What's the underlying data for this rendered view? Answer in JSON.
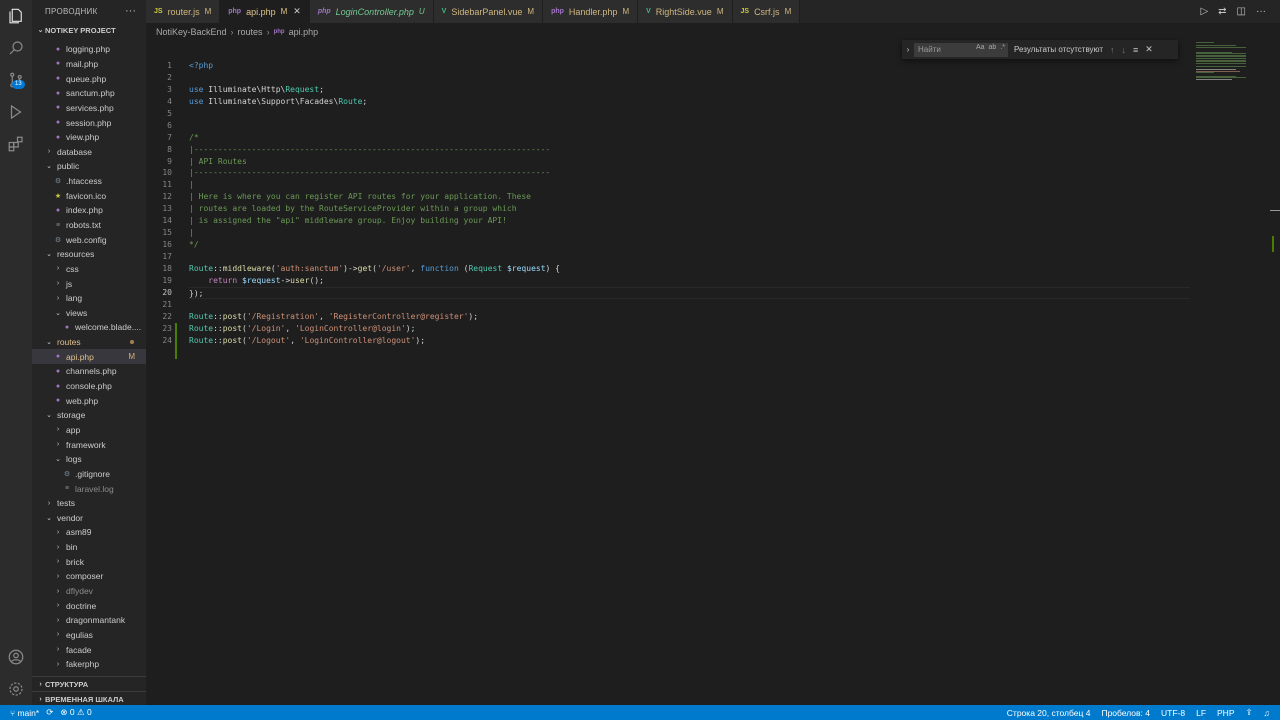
{
  "activity": {
    "icons": [
      "explorer-icon",
      "search-icon",
      "source-control-icon",
      "run-debug-icon",
      "extensions-icon",
      "account-icon",
      "manage-gear-icon"
    ],
    "source_control_badge": "13"
  },
  "sidebar": {
    "title": "ПРОВОДНИК",
    "more": "···",
    "project": "NOTIKEY PROJECT",
    "tree": [
      {
        "label": "logging.php",
        "type": "php",
        "indent": 2
      },
      {
        "label": "mail.php",
        "type": "php",
        "indent": 2
      },
      {
        "label": "queue.php",
        "type": "php",
        "indent": 2
      },
      {
        "label": "sanctum.php",
        "type": "php",
        "indent": 2
      },
      {
        "label": "services.php",
        "type": "php",
        "indent": 2
      },
      {
        "label": "session.php",
        "type": "php",
        "indent": 2
      },
      {
        "label": "view.php",
        "type": "php",
        "indent": 2
      },
      {
        "label": "database",
        "type": "folder-closed",
        "indent": 1
      },
      {
        "label": "public",
        "type": "folder-open",
        "indent": 1
      },
      {
        "label": ".htaccess",
        "type": "gear",
        "indent": 2
      },
      {
        "label": "favicon.ico",
        "type": "star",
        "indent": 2
      },
      {
        "label": "index.php",
        "type": "php",
        "indent": 2
      },
      {
        "label": "robots.txt",
        "type": "lines",
        "indent": 2
      },
      {
        "label": "web.config",
        "type": "gear",
        "indent": 2
      },
      {
        "label": "resources",
        "type": "folder-open",
        "indent": 1
      },
      {
        "label": "css",
        "type": "folder-closed",
        "indent": 2
      },
      {
        "label": "js",
        "type": "folder-closed",
        "indent": 2
      },
      {
        "label": "lang",
        "type": "folder-closed",
        "indent": 2
      },
      {
        "label": "views",
        "type": "folder-open",
        "indent": 2
      },
      {
        "label": "welcome.blade....",
        "type": "php",
        "indent": 3
      },
      {
        "label": "routes",
        "type": "folder-open",
        "indent": 1,
        "status": "dot"
      },
      {
        "label": "api.php",
        "type": "php",
        "indent": 2,
        "status": "M",
        "selected": true
      },
      {
        "label": "channels.php",
        "type": "php",
        "indent": 2
      },
      {
        "label": "console.php",
        "type": "php",
        "indent": 2
      },
      {
        "label": "web.php",
        "type": "php",
        "indent": 2
      },
      {
        "label": "storage",
        "type": "folder-open",
        "indent": 1
      },
      {
        "label": "app",
        "type": "folder-closed",
        "indent": 2
      },
      {
        "label": "framework",
        "type": "folder-closed",
        "indent": 2
      },
      {
        "label": "logs",
        "type": "folder-open",
        "indent": 2
      },
      {
        "label": ".gitignore",
        "type": "gear",
        "indent": 3
      },
      {
        "label": "laravel.log",
        "type": "lines",
        "indent": 3,
        "dim": true
      },
      {
        "label": "tests",
        "type": "folder-closed",
        "indent": 1
      },
      {
        "label": "vendor",
        "type": "folder-open",
        "indent": 1
      },
      {
        "label": "asm89",
        "type": "folder-closed",
        "indent": 2
      },
      {
        "label": "bin",
        "type": "folder-closed",
        "indent": 2
      },
      {
        "label": "brick",
        "type": "folder-closed",
        "indent": 2
      },
      {
        "label": "composer",
        "type": "folder-closed",
        "indent": 2
      },
      {
        "label": "dflydev",
        "type": "folder-closed",
        "indent": 2,
        "dim": true
      },
      {
        "label": "doctrine",
        "type": "folder-closed",
        "indent": 2
      },
      {
        "label": "dragonmantank",
        "type": "folder-closed",
        "indent": 2
      },
      {
        "label": "egulias",
        "type": "folder-closed",
        "indent": 2
      },
      {
        "label": "facade",
        "type": "folder-closed",
        "indent": 2
      },
      {
        "label": "fakerphp",
        "type": "folder-closed",
        "indent": 2
      }
    ],
    "outline": "СТРУКТУРА",
    "timeline": "ВРЕМЕННАЯ ШКАЛА"
  },
  "tabs": [
    {
      "icon": "JS",
      "label": "router.js",
      "mark": "M",
      "kind": "js"
    },
    {
      "icon": "php",
      "label": "api.php",
      "mark": "M",
      "kind": "php",
      "active": true,
      "close": "✕"
    },
    {
      "icon": "php",
      "label": "LoginController.php",
      "mark": "U",
      "kind": "php",
      "untracked": true
    },
    {
      "icon": "V",
      "label": "SidebarPanel.vue",
      "mark": "M",
      "kind": "vue"
    },
    {
      "icon": "php",
      "label": "Handler.php",
      "mark": "M",
      "kind": "php"
    },
    {
      "icon": "V",
      "label": "RightSide.vue",
      "mark": "M",
      "kind": "vue"
    },
    {
      "icon": "JS",
      "label": "Csrf.js",
      "mark": "M",
      "kind": "js"
    }
  ],
  "breadcrumb": {
    "root": "NotiKey-BackEnd",
    "folder": "routes",
    "file": "api.php",
    "sep": "›"
  },
  "find": {
    "placeholder": "Найти",
    "opt_case": "Aa",
    "opt_word": "ab",
    "opt_regex": ".*",
    "result": "Результаты отсутствуют",
    "prev": "↑",
    "next": "↓",
    "selection": "≡",
    "close": "✕"
  },
  "editor": {
    "current_line": 20,
    "lines": [
      {
        "n": "1",
        "t": [
          [
            "tag",
            "<?php"
          ]
        ]
      },
      {
        "n": "2",
        "t": []
      },
      {
        "n": "3",
        "t": [
          [
            "kw",
            "use"
          ],
          [
            "",
            " Illuminate\\Http\\"
          ],
          [
            "cls",
            "Request"
          ],
          [
            "",
            ";"
          ]
        ]
      },
      {
        "n": "4",
        "t": [
          [
            "kw",
            "use"
          ],
          [
            "",
            " Illuminate\\Support\\Facades\\"
          ],
          [
            "cls",
            "Route"
          ],
          [
            "",
            ";"
          ]
        ]
      },
      {
        "n": "5",
        "t": []
      },
      {
        "n": "6",
        "t": []
      },
      {
        "n": "7",
        "t": [
          [
            "com",
            "/*"
          ]
        ]
      },
      {
        "n": "8",
        "t": [
          [
            "com",
            "|--------------------------------------------------------------------------"
          ]
        ]
      },
      {
        "n": "9",
        "t": [
          [
            "com",
            "| API Routes"
          ]
        ]
      },
      {
        "n": "10",
        "t": [
          [
            "com",
            "|--------------------------------------------------------------------------"
          ]
        ]
      },
      {
        "n": "11",
        "t": [
          [
            "com",
            "|"
          ]
        ]
      },
      {
        "n": "12",
        "t": [
          [
            "com",
            "| Here is where you can register API routes for your application. These"
          ]
        ]
      },
      {
        "n": "13",
        "t": [
          [
            "com",
            "| routes are loaded by the RouteServiceProvider within a group which"
          ]
        ]
      },
      {
        "n": "14",
        "t": [
          [
            "com",
            "| is assigned the \"api\" middleware group. Enjoy building your API!"
          ]
        ]
      },
      {
        "n": "15",
        "t": [
          [
            "com",
            "|"
          ]
        ]
      },
      {
        "n": "16",
        "t": [
          [
            "com",
            "*/"
          ]
        ]
      },
      {
        "n": "17",
        "t": []
      },
      {
        "n": "18",
        "t": [
          [
            "cls",
            "Route"
          ],
          [
            "",
            "::"
          ],
          [
            "fn",
            "middleware"
          ],
          [
            "",
            "("
          ],
          [
            "str",
            "'auth:sanctum'"
          ],
          [
            "",
            ")->"
          ],
          [
            "fn",
            "get"
          ],
          [
            "",
            "("
          ],
          [
            "str",
            "'/user'"
          ],
          [
            "",
            ", "
          ],
          [
            "kw",
            "function"
          ],
          [
            "",
            " ("
          ],
          [
            "cls",
            "Request"
          ],
          [
            "",
            " "
          ],
          [
            "var",
            "$request"
          ],
          [
            "",
            ") {"
          ]
        ]
      },
      {
        "n": "19",
        "t": [
          [
            "",
            "    "
          ],
          [
            "ctl",
            "return"
          ],
          [
            "",
            " "
          ],
          [
            "var",
            "$request"
          ],
          [
            "",
            "->"
          ],
          [
            "fn",
            "user"
          ],
          [
            "",
            "();"
          ]
        ]
      },
      {
        "n": "20",
        "t": [
          [
            "",
            "});"
          ]
        ]
      },
      {
        "n": "21",
        "t": []
      },
      {
        "n": "22",
        "t": [
          [
            "cls",
            "Route"
          ],
          [
            "",
            "::"
          ],
          [
            "fn",
            "post"
          ],
          [
            "",
            "("
          ],
          [
            "str",
            "'/Registration'"
          ],
          [
            "",
            ", "
          ],
          [
            "str",
            "'RegisterController@register'"
          ],
          [
            "",
            ");"
          ]
        ]
      },
      {
        "n": "23",
        "t": [
          [
            "cls",
            "Route"
          ],
          [
            "",
            "::"
          ],
          [
            "fn",
            "post"
          ],
          [
            "",
            "("
          ],
          [
            "str",
            "'/Login'"
          ],
          [
            "",
            ", "
          ],
          [
            "str",
            "'LoginController@login'"
          ],
          [
            "",
            ");"
          ]
        ]
      },
      {
        "n": "24",
        "t": [
          [
            "cls",
            "Route"
          ],
          [
            "",
            "::"
          ],
          [
            "fn",
            "post"
          ],
          [
            "",
            "("
          ],
          [
            "str",
            "'/Logout'"
          ],
          [
            "",
            ", "
          ],
          [
            "str",
            "'LoginController@logout'"
          ],
          [
            "",
            ");"
          ]
        ]
      }
    ]
  },
  "status": {
    "branch": "main*",
    "sync": "⟳",
    "errors": "0",
    "warnings": "0",
    "position": "Строка 20, столбец 4",
    "spaces": "Пробелов: 4",
    "encoding": "UTF-8",
    "eol": "LF",
    "language": "PHP"
  }
}
